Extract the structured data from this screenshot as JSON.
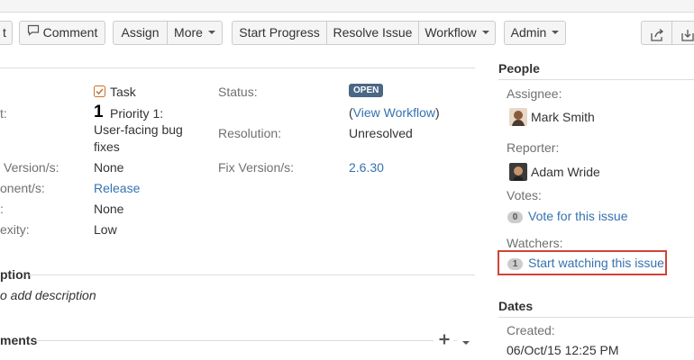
{
  "toolbar": {
    "edit_partial": "t",
    "comment": "Comment",
    "assign": "Assign",
    "more": "More",
    "start_progress": "Start Progress",
    "resolve_issue": "Resolve Issue",
    "workflow": "Workflow",
    "admin": "Admin"
  },
  "details": {
    "type_value": "Task",
    "priority_label": "t:",
    "priority_value_line1": "Priority 1:",
    "priority_value_line2": "User-facing bug",
    "priority_value_line3": "fixes",
    "affects_label": "Version/s:",
    "affects_value": "None",
    "component_label": "onent/s:",
    "component_value": "Release",
    "labels_label": ":",
    "labels_value": "None",
    "complexity_label": "exity:",
    "complexity_value": "Low",
    "status_label": "Status:",
    "status_value": "OPEN",
    "view_workflow_open": "(",
    "view_workflow": "View Workflow",
    "view_workflow_close": ")",
    "resolution_label": "Resolution:",
    "resolution_value": "Unresolved",
    "fix_label": "Fix Version/s:",
    "fix_value": "2.6.30"
  },
  "description": {
    "heading": "ption",
    "placeholder": "o add description"
  },
  "comments": {
    "heading": "ments"
  },
  "people": {
    "heading": "People",
    "assignee_label": "Assignee:",
    "assignee_name": "Mark Smith",
    "reporter_label": "Reporter:",
    "reporter_name": "Adam Wride",
    "votes_label": "Votes:",
    "votes_count": "0",
    "vote_link": "Vote for this issue",
    "watchers_label": "Watchers:",
    "watchers_count": "1",
    "watch_link": "Start watching this issue"
  },
  "dates": {
    "heading": "Dates",
    "created_label": "Created:",
    "created_value": "06/Oct/15 12:25 PM"
  },
  "colors": {
    "link": "#3572b0",
    "status_lozenge": "#4a6785",
    "highlight_box": "#d04437"
  }
}
